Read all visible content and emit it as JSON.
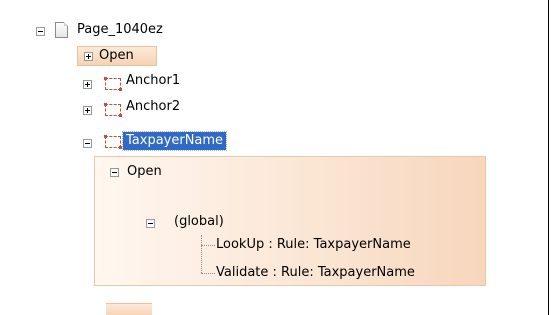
{
  "tree": {
    "root": {
      "label": "Page_1040ez"
    },
    "open_node": {
      "label": "Open"
    },
    "anchors": [
      {
        "label": "Anchor1"
      },
      {
        "label": "Anchor2"
      },
      {
        "label": "TaxpayerName"
      }
    ],
    "taxpayer_open": {
      "label": "Open",
      "global": {
        "label": "(global)",
        "rules": [
          {
            "label": "LookUp : Rule: TaxpayerName"
          },
          {
            "label": "Validate : Rule: TaxpayerName"
          }
        ]
      }
    }
  },
  "colors": {
    "selection": "#316ac5",
    "event_highlight": "#f6d3b4",
    "anchor_icon": "#c84c3c"
  },
  "icons": {
    "root": "page-icon",
    "anchor": "anchor-region-icon"
  }
}
